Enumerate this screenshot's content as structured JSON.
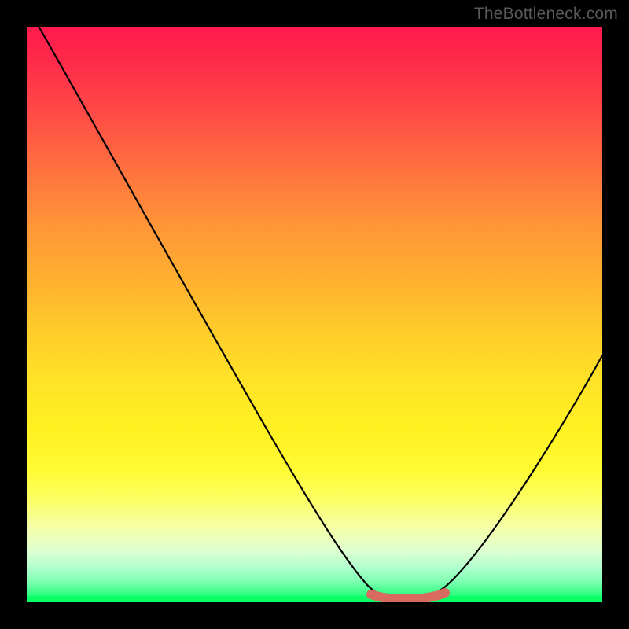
{
  "watermark": "TheBottleneck.com",
  "chart_data": {
    "type": "line",
    "title": "",
    "xlabel": "",
    "ylabel": "",
    "xlim": [
      0,
      100
    ],
    "ylim": [
      0,
      100
    ],
    "grid": false,
    "legend": false,
    "series": [
      {
        "name": "bottleneck-curve",
        "x": [
          0,
          5,
          10,
          15,
          20,
          25,
          30,
          35,
          40,
          45,
          50,
          55,
          58,
          60,
          62,
          65,
          68,
          72,
          75,
          78,
          82,
          86,
          90,
          94,
          98,
          100
        ],
        "values": [
          100,
          93,
          85,
          77,
          69,
          61,
          53,
          45,
          37,
          29,
          21,
          12,
          7,
          3,
          1.2,
          0.6,
          0.6,
          1.2,
          3,
          6,
          12,
          19,
          26,
          33,
          40,
          44
        ]
      }
    ],
    "highlight": {
      "name": "min-region",
      "x_start": 60,
      "x_end": 73,
      "color": "#d86a60"
    },
    "background_gradient_stops": [
      {
        "pos": 0,
        "color": "#ff1a4d"
      },
      {
        "pos": 50,
        "color": "#ffcf2a"
      },
      {
        "pos": 80,
        "color": "#fdff62"
      },
      {
        "pos": 100,
        "color": "#0dff68"
      }
    ]
  }
}
